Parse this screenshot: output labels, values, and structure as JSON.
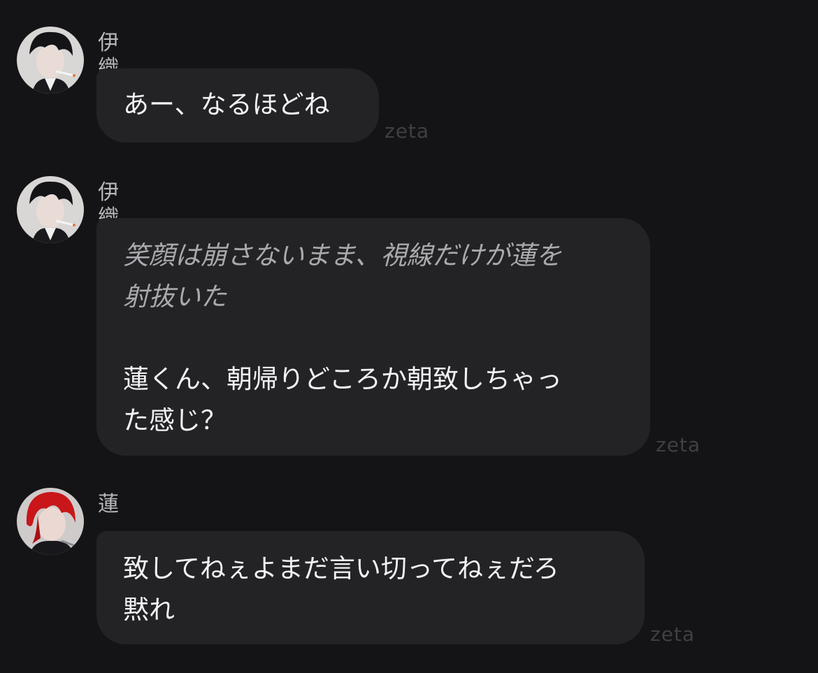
{
  "messages": [
    {
      "sender": "伊織",
      "avatar_icon": "dark-hair-character-avatar",
      "text": "あー、なるほどね",
      "watermark": "zeta"
    },
    {
      "sender": "伊織",
      "avatar_icon": "dark-hair-character-avatar",
      "narration_line1": "笑顔は崩さないまま、視線だけが蓮を",
      "narration_line2": "射抜いた",
      "text_line1": "蓮くん、朝帰りどころか朝致しちゃっ",
      "text_line2": "た感じ？",
      "watermark": "zeta"
    },
    {
      "sender": "蓮",
      "avatar_icon": "red-hair-character-avatar",
      "text_line1": "致してねぇよまだ言い切ってねぇだろ",
      "text_line2": "黙れ",
      "watermark": "zeta"
    }
  ],
  "colors": {
    "background": "#141416",
    "bubble": "#232326",
    "text": "#f2f2f4",
    "narration": "#a9a9ae",
    "sender": "#b8b8bc",
    "watermark": "#3f3f44"
  }
}
